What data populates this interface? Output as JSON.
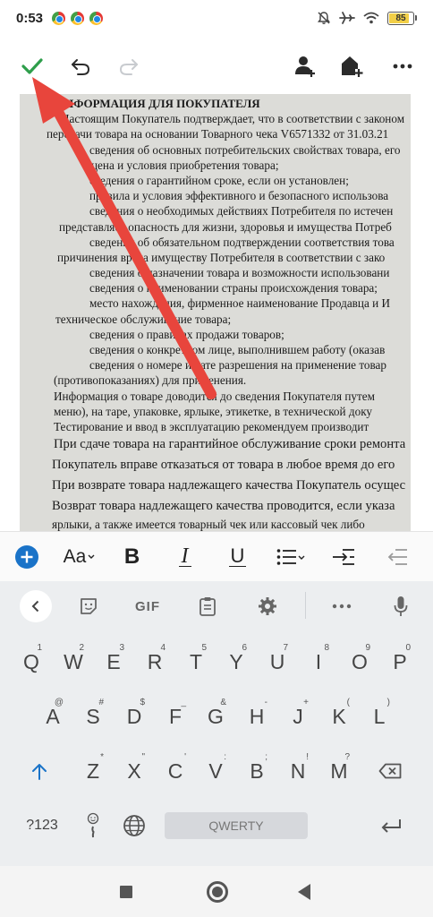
{
  "status_bar": {
    "time": "0:53",
    "notification_icons": [
      "chrome-icon",
      "chrome-icon",
      "chrome-icon"
    ],
    "system_icons": [
      "mute-bell-icon",
      "airplane-icon",
      "wifi-icon"
    ],
    "battery_level": "85",
    "battery_percent": 85
  },
  "toolbar": {
    "buttons": [
      "checkmark-icon",
      "undo-icon",
      "redo-icon",
      "add-person-icon",
      "add-to-home-icon",
      "more-icon"
    ],
    "colors": {
      "check": "#2e9e4b",
      "redo_disabled": "#c8cbcf",
      "icon": "#2b2b2b"
    }
  },
  "document": {
    "lines": [
      "ИНФОРМАЦИЯ ДЛЯ ПОКУПАТЕЛЯ",
      "Настоящим Покупатель подтверждает, что в соответствии с законом",
      "передачи товара на основании Товарного чека V6571332 от 31.03.21",
      "сведения об основных потребительских свойствах товара, его",
      "цена и условия приобретения товара;",
      "сведения о гарантийном сроке, если он установлен;",
      "правила и условия эффективного и безопасного использова",
      "сведения о необходимых действиях Потребителя по истечен",
      "представляет опасность для жизни, здоровья и имущества Потреб",
      "сведения об обязательном подтверждении соответствия това",
      "причинения вреда имуществу Потребителя в соответствии с зако",
      "сведения о назначении товара и возможности использовани",
      "сведения о наименовании страны происхождения товара;",
      "место нахождения, фирменное наименование Продавца и И",
      "техническое обслуживание товара;",
      "сведения о правилах продажи товаров;",
      "сведения о конкретном лице, выполнившем работу (оказав",
      "сведения о номере и дате разрешения на применение товар",
      "(противопоказаниях) для применения.",
      "Информация о товаре доводится до сведения Покупателя путем",
      "меню), на таре, упаковке, ярлыке, этикетке, в технической доку",
      "Тестирование и ввод в эксплуатацию рекомендуем производит",
      "При сдаче товара на гарантийное обслуживание сроки ремонта",
      "Покупатель вправе отказаться от товара в любое время до его",
      "При возврате товара надлежащего качества Покупатель осущес",
      "Возврат товара надлежащего качества проводится, если указа",
      "ярлыки, а также имеется товарный чек или кассовый чек либо"
    ]
  },
  "annotation": {
    "arrow_color": "#e8453c"
  },
  "format_bar": {
    "buttons": [
      "add-icon",
      "font-size-icon",
      "bold-icon",
      "italic-icon",
      "underline-icon",
      "bullet-list-icon",
      "indent-icon",
      "outdent-icon"
    ],
    "font_label": "Aa",
    "bold_label": "B",
    "italic_label": "I",
    "underline_label": "U",
    "add_color": "#1a73c8"
  },
  "keyboard": {
    "tools": [
      "back-icon",
      "sticker-icon",
      "gif-icon",
      "clipboard-icon",
      "settings-icon",
      "more-icon",
      "microphone-icon"
    ],
    "gif_label": "GIF",
    "row1": [
      [
        "Q",
        "1"
      ],
      [
        "W",
        "2"
      ],
      [
        "E",
        "3"
      ],
      [
        "R",
        "4"
      ],
      [
        "T",
        "5"
      ],
      [
        "Y",
        "6"
      ],
      [
        "U",
        "7"
      ],
      [
        "I",
        "8"
      ],
      [
        "O",
        "9"
      ],
      [
        "P",
        "0"
      ]
    ],
    "row2": [
      [
        "A",
        "@"
      ],
      [
        "S",
        "#"
      ],
      [
        "D",
        "$"
      ],
      [
        "F",
        "_"
      ],
      [
        "G",
        "&"
      ],
      [
        "H",
        "-"
      ],
      [
        "J",
        "+"
      ],
      [
        "K",
        "("
      ],
      [
        "L",
        ")"
      ]
    ],
    "row3": [
      [
        "Z",
        "*"
      ],
      [
        "X",
        "\""
      ],
      [
        "C",
        "'"
      ],
      [
        "V",
        ":"
      ],
      [
        "B",
        ";"
      ],
      [
        "N",
        "!"
      ],
      [
        "M",
        "?"
      ]
    ],
    "symbols_label": "?123",
    "space_label": "QWERTY",
    "shift_color": "#1a73c8"
  },
  "nav_bar": {
    "buttons": [
      "recent-apps-icon",
      "home-icon",
      "back-icon"
    ]
  }
}
